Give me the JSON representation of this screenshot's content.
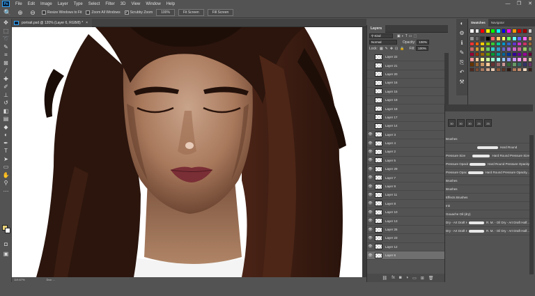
{
  "app": {
    "logo": "Ps"
  },
  "menu": [
    "File",
    "Edit",
    "Image",
    "Layer",
    "Type",
    "Select",
    "Filter",
    "3D",
    "View",
    "Window",
    "Help"
  ],
  "window_controls": {
    "minimize": "—",
    "restore": "❐",
    "close": "✕"
  },
  "options_bar": {
    "resize_windows": "Resize Windows to Fit",
    "zoom_all": "Zoom All Windows",
    "scrubby_zoom": "Scrubby Zoom",
    "zoom_100": "100%",
    "fit_screen": "Fit Screen",
    "fill_screen": "Fill Screen"
  },
  "document": {
    "tab_title": "portrait.psd @ 120% (Layer 6, RGB/8) *",
    "close": "×"
  },
  "status": {
    "zoom": "119.67%",
    "doc": "Doc: ..."
  },
  "layers_panel": {
    "title": "Layers",
    "kind": "Kind",
    "blend_mode": "Normal",
    "opacity_label": "Opacity:",
    "opacity_value": "100%",
    "lock_label": "Lock:",
    "fill_label": "Fill:",
    "fill_value": "100%",
    "layers": [
      {
        "name": "Layer 22",
        "visible": false
      },
      {
        "name": "Layer 21",
        "visible": false
      },
      {
        "name": "Layer 20",
        "visible": false
      },
      {
        "name": "Layer 16",
        "visible": false
      },
      {
        "name": "Layer 15",
        "visible": false
      },
      {
        "name": "Layer 19",
        "visible": false
      },
      {
        "name": "Layer 18",
        "visible": false
      },
      {
        "name": "Layer 17",
        "visible": false
      },
      {
        "name": "Layer 14",
        "visible": false
      },
      {
        "name": "Layer 3",
        "visible": true
      },
      {
        "name": "Layer 4",
        "visible": true
      },
      {
        "name": "Layer 2",
        "visible": true
      },
      {
        "name": "Layer 5",
        "visible": true
      },
      {
        "name": "Layer 29",
        "visible": true
      },
      {
        "name": "Layer 7",
        "visible": true
      },
      {
        "name": "Layer 9",
        "visible": true
      },
      {
        "name": "Layer 11",
        "visible": true
      },
      {
        "name": "Layer 8",
        "visible": true
      },
      {
        "name": "Layer 10",
        "visible": true
      },
      {
        "name": "Layer 13",
        "visible": true
      },
      {
        "name": "Layer 26",
        "visible": true
      },
      {
        "name": "Layer 23",
        "visible": true
      },
      {
        "name": "Layer 12",
        "visible": true
      },
      {
        "name": "Layer 6",
        "visible": true,
        "selected": true
      }
    ]
  },
  "right_panel": {
    "tab_swatches": "Swatches",
    "tab_navigator": "Navigator"
  },
  "brushes": {
    "tip_sizes": [
      "30",
      "30",
      "30",
      "25",
      "25"
    ],
    "items": [
      {
        "label": "Brushes",
        "right": ""
      },
      {
        "label": "",
        "right": "Hard Round"
      },
      {
        "label": "Pressure Size",
        "right": "Hard Round Pressure Size"
      },
      {
        "label": "Pressure Opacity",
        "right": "Hard Round Pressure Opacity"
      },
      {
        "label": "Pressure Opacity a...",
        "right": "Hard Round Pressure Opacity..."
      },
      {
        "label": "Brushes",
        "right": ""
      },
      {
        "label": "Brushes",
        "right": ""
      },
      {
        "label": "Effects Brushes",
        "right": ""
      },
      {
        "label": "Ink",
        "right": ""
      },
      {
        "label": "Gouache Oil (dry)",
        "right": ""
      },
      {
        "label": "Dry - Art Draft Half...",
        "right": "R. M. - Oil Dry - Art Draft Half..."
      },
      {
        "label": "Dry - Art Draft Half...",
        "right": "R. M. - Oil Dry - Art Draft Half..."
      }
    ]
  },
  "swatch_colors": [
    "#ffffff",
    "#e8e8e8",
    "#ff0000",
    "#ffff00",
    "#00ff00",
    "#00ffff",
    "#0000ff",
    "#ff00ff",
    "#ff9900",
    "#cc0000",
    "#990000",
    "#cccccc",
    "#999999",
    "#666666",
    "#333333",
    "#000000",
    "#ff6666",
    "#ffcc66",
    "#ffff66",
    "#66ff66",
    "#66ffff",
    "#6666ff",
    "#ff66ff",
    "#cc9966",
    "#ff3333",
    "#ff6600",
    "#ffcc00",
    "#99cc00",
    "#33cc33",
    "#00cc99",
    "#0099cc",
    "#3366cc",
    "#6633cc",
    "#cc33cc",
    "#cc3366",
    "#996633",
    "#cc6666",
    "#cc9933",
    "#cccc33",
    "#66cc66",
    "#33cccc",
    "#3399cc",
    "#6666cc",
    "#9966cc",
    "#cc66cc",
    "#cc6699",
    "#99cc66",
    "#669966",
    "#990033",
    "#993300",
    "#996600",
    "#669900",
    "#009933",
    "#009999",
    "#006699",
    "#003399",
    "#330099",
    "#660099",
    "#990099",
    "#660033",
    "#ff9999",
    "#ffcc99",
    "#ffff99",
    "#ccff99",
    "#99ffcc",
    "#99ffff",
    "#99ccff",
    "#9999ff",
    "#cc99ff",
    "#ff99ff",
    "#ff99cc",
    "#cccc99",
    "#663300",
    "#996633",
    "#cc9966",
    "#ffcc99",
    "#663333",
    "#996666",
    "#cc9999",
    "#336633",
    "#669966",
    "#336666",
    "#333366",
    "#663366",
    "#4d2a1f",
    "#7a4b35",
    "#a8785e",
    "#d4a88a",
    "#e8c9b0",
    "#8c5a3c",
    "#5c3526",
    "#2e1a14",
    "#b07a5a",
    "#c89070",
    "#f0d8c0",
    "#3a2018"
  ]
}
